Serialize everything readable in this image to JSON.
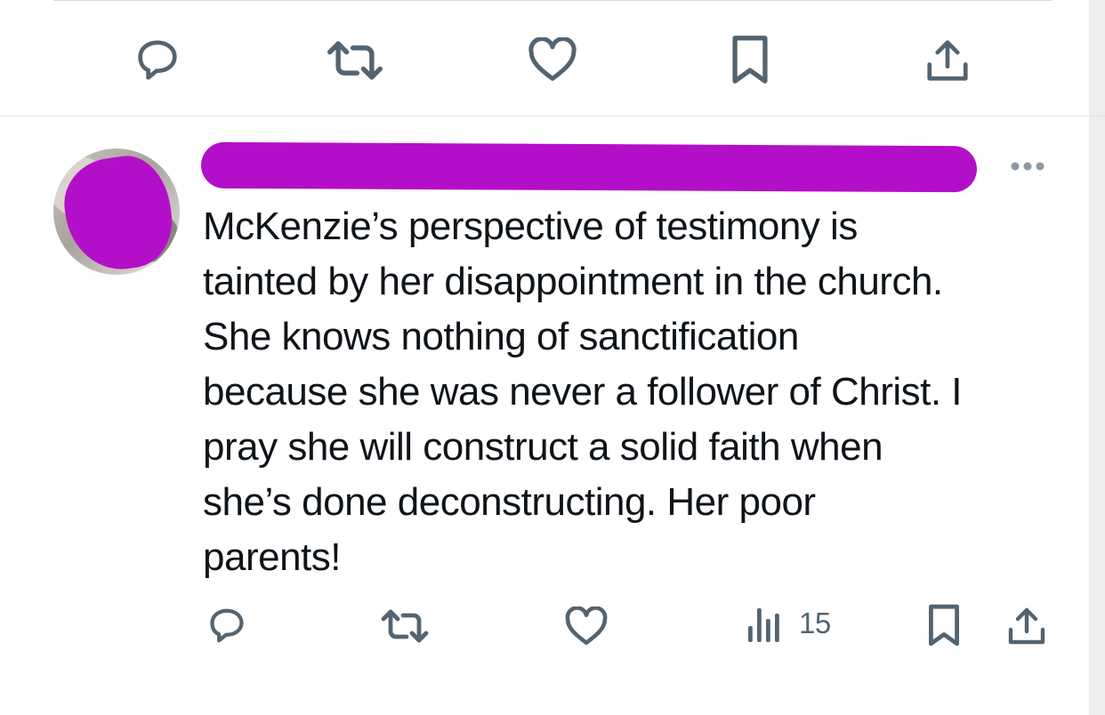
{
  "previous_tweet": {
    "actions": [
      {
        "name": "reply",
        "icon": "reply-icon"
      },
      {
        "name": "retweet",
        "icon": "retweet-icon"
      },
      {
        "name": "like",
        "icon": "heart-icon"
      },
      {
        "name": "bookmark",
        "icon": "bookmark-icon"
      },
      {
        "name": "share",
        "icon": "share-icon"
      }
    ]
  },
  "tweet": {
    "author_redacted": true,
    "avatar_redacted": true,
    "more_icon": "more-horizontal-icon",
    "text": "McKenzie’s perspective of testimony is\ntainted by her disappointment in the church.\nShe knows nothing of sanctification\nbecause she was never a follower of Christ. I\npray she will construct a solid faith when\nshe’s done deconstructing. Her poor\nparents!",
    "views": "15",
    "actions": [
      {
        "name": "reply",
        "icon": "reply-icon"
      },
      {
        "name": "retweet",
        "icon": "retweet-icon"
      },
      {
        "name": "like",
        "icon": "heart-icon"
      },
      {
        "name": "views",
        "icon": "views-icon"
      },
      {
        "name": "bookmark",
        "icon": "bookmark-icon"
      },
      {
        "name": "share",
        "icon": "share-icon"
      }
    ]
  },
  "colors": {
    "icon": "#536471",
    "text": "#0f1419",
    "redaction": "#b40fc8",
    "divider": "#dfe4e7"
  }
}
